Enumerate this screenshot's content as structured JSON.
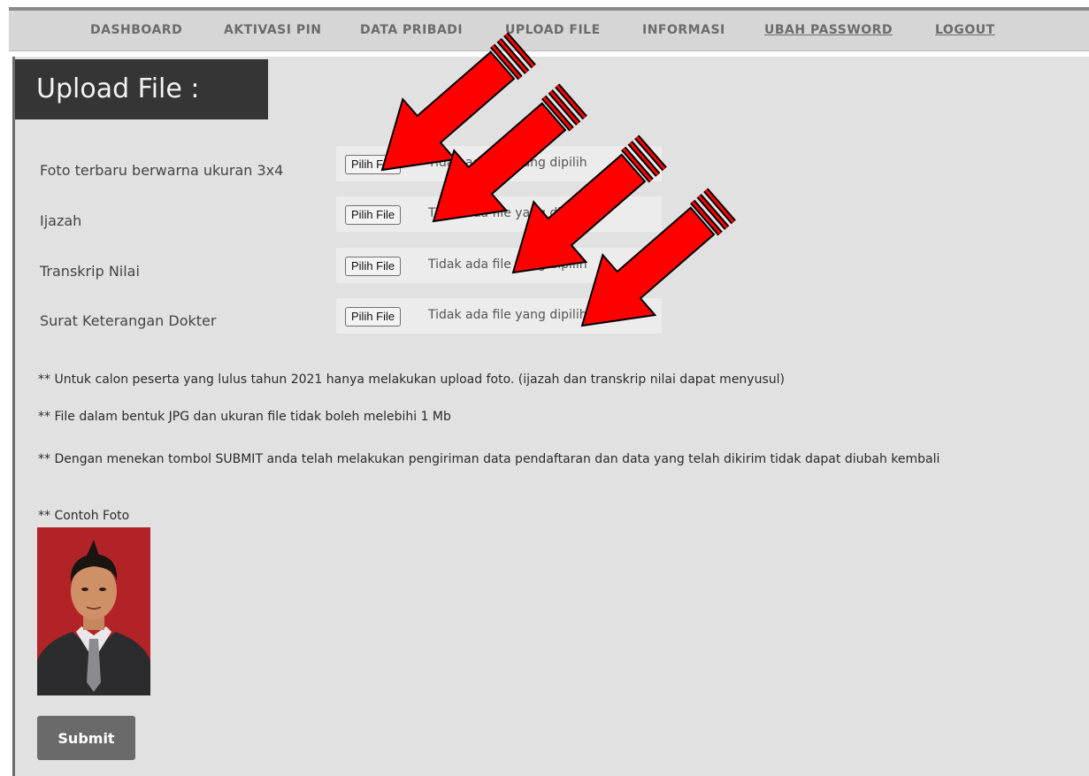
{
  "nav": {
    "items": [
      {
        "label": "DASHBOARD"
      },
      {
        "label": "AKTIVASI PIN"
      },
      {
        "label": "DATA PRIBADI"
      },
      {
        "label": "UPLOAD FILE"
      },
      {
        "label": "INFORMASI"
      },
      {
        "label": "UBAH PASSWORD"
      },
      {
        "label": "LOGOUT"
      }
    ]
  },
  "page": {
    "title": "Upload File :"
  },
  "fields": [
    {
      "label": "Foto terbaru berwarna ukuran 3x4",
      "button": "Pilih File",
      "status": "Tidak ada file yang dipilih"
    },
    {
      "label": "Ijazah",
      "button": "Pilih File",
      "status": "Tidak ada file yang dipilih"
    },
    {
      "label": "Transkrip Nilai",
      "button": "Pilih File",
      "status": "Tidak ada file yang dipilih"
    },
    {
      "label": "Surat Keterangan Dokter",
      "button": "Pilih File",
      "status": "Tidak ada file yang dipilih"
    }
  ],
  "notes": [
    "** Untuk calon peserta yang lulus tahun 2021 hanya melakukan upload foto. (ijazah dan transkrip nilai dapat menyusul)",
    "** File dalam bentuk JPG dan ukuran file tidak boleh melebihi 1 Mb",
    "** Dengan menekan tombol SUBMIT anda telah melakukan pengiriman data pendaftaran dan data yang telah dikirim tidak dapat diubah kembali"
  ],
  "example_photo": {
    "label": "** Contoh Foto"
  },
  "submit": {
    "label": "Submit"
  },
  "colors": {
    "arrow": "#ff0000",
    "title_bg": "#353535",
    "panel_bg": "#e1e1e1",
    "submit_bg": "#6a6a6a"
  }
}
